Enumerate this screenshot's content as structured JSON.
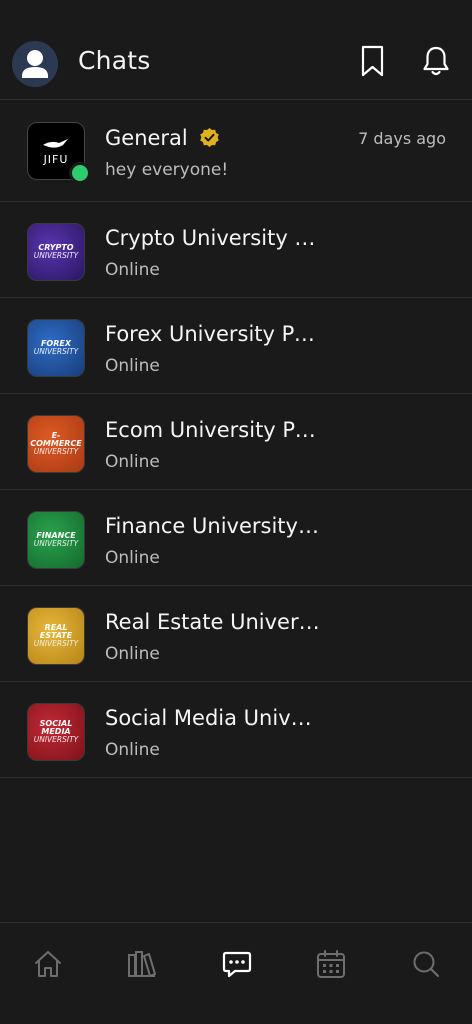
{
  "header": {
    "title": "Chats",
    "avatar_icon": "user-avatar-icon",
    "bookmark_icon": "bookmark-icon",
    "bell_icon": "bell-icon"
  },
  "chats": [
    {
      "title": "General",
      "subtitle": "hey everyone!",
      "time": "7 days ago",
      "verified": true,
      "online_dot": true,
      "thumb_logo": "JIFU",
      "thumb_color": "#000000"
    },
    {
      "title": "Crypto University P...",
      "subtitle": "Online",
      "thumb_line1": "CRYPTO",
      "thumb_line2": "UNIVERSITY",
      "thumb_color": "#3a1f7a"
    },
    {
      "title": "Forex University Pre...",
      "subtitle": "Online",
      "thumb_line1": "FOREX",
      "thumb_line2": "UNIVERSITY",
      "thumb_color": "#1f4f9a"
    },
    {
      "title": "Ecom University Pr...",
      "subtitle": "Online",
      "thumb_line1": "E-COMMERCE",
      "thumb_line2": "UNIVERSITY",
      "thumb_color": "#c8471b"
    },
    {
      "title": "Finance University ...",
      "subtitle": "Online",
      "thumb_line1": "FINANCE",
      "thumb_line2": "UNIVERSITY",
      "thumb_color": "#1f8a3f"
    },
    {
      "title": "Real Estate Univers...",
      "subtitle": "Online",
      "thumb_line1": "REAL ESTATE",
      "thumb_line2": "UNIVERSITY",
      "thumb_color": "#d4a22a"
    },
    {
      "title": "Social Media Unive...",
      "subtitle": "Online",
      "thumb_line1": "SOCIAL MEDIA",
      "thumb_line2": "UNIVERSITY",
      "thumb_color": "#a01c27"
    }
  ],
  "bottom_nav": {
    "items": [
      {
        "icon": "home-icon",
        "active": false
      },
      {
        "icon": "library-icon",
        "active": false
      },
      {
        "icon": "chat-icon",
        "active": true
      },
      {
        "icon": "calendar-icon",
        "active": false
      },
      {
        "icon": "search-icon",
        "active": false
      }
    ]
  },
  "colors": {
    "background": "#1a1a1a",
    "divider": "#2e2e2e",
    "online": "#2ecc71",
    "verified": "#e0b020",
    "muted_text": "#bdbdbd",
    "nav_inactive": "#6e6e6e",
    "nav_active": "#ffffff"
  }
}
